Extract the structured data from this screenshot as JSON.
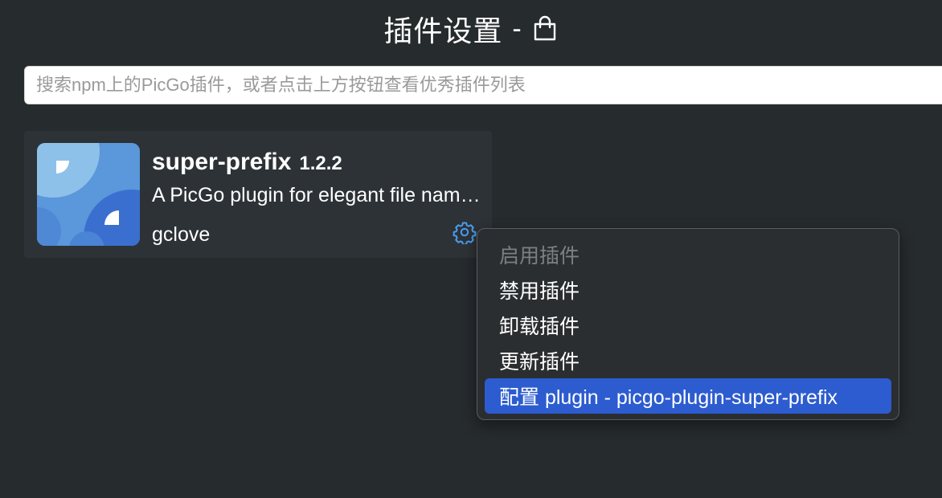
{
  "header": {
    "title": "插件设置",
    "separator": "-",
    "icon": "shopping-bag-icon"
  },
  "search": {
    "value": "",
    "placeholder": "搜索npm上的PicGo插件，或者点击上方按钮查看优秀插件列表"
  },
  "plugin": {
    "name": "super-prefix",
    "version": "1.2.2",
    "description": "A PicGo plugin for elegant file name prefix",
    "author": "gclove",
    "logo_icon": "plugin-logo",
    "settings_icon": "gear-icon",
    "accent_color": "#4a9df0"
  },
  "context_menu": {
    "items": [
      {
        "label": "启用插件",
        "disabled": true
      },
      {
        "label": "禁用插件",
        "disabled": false
      },
      {
        "label": "卸载插件",
        "disabled": false
      },
      {
        "label": "更新插件",
        "disabled": false
      },
      {
        "label": "配置 plugin - picgo-plugin-super-prefix",
        "disabled": false,
        "selected": true
      }
    ],
    "highlight_color": "#2c5ccf"
  }
}
